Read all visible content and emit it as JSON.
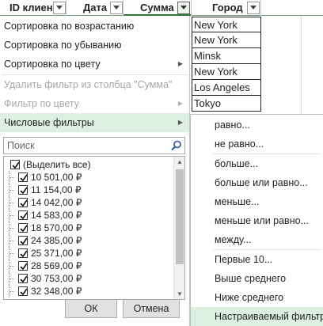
{
  "headers": {
    "id": "ID клиен",
    "date": "Дата",
    "sum": "Сумма",
    "city": "Город"
  },
  "cities": [
    "New York",
    "New York",
    "Minsk",
    "New York",
    "Los Angeles",
    "Tokyo"
  ],
  "menu": {
    "sort_asc": "Сортировка по возрастанию",
    "sort_desc": "Сортировка по убыванию",
    "sort_color": "Сортировка по цвету",
    "clear_filter": "Удалить фильтр из столбца \"Сумма\"",
    "filter_color": "Фильтр по цвету",
    "number_filters": "Числовые фильтры"
  },
  "search": {
    "placeholder": "Поиск"
  },
  "values": {
    "select_all": "(Выделить все)",
    "items": [
      "10 501,00 ₽",
      "11 154,00 ₽",
      "14 042,00 ₽",
      "14 583,00 ₽",
      "18 570,00 ₽",
      "24 385,00 ₽",
      "25 371,00 ₽",
      "28 569,00 ₽",
      "30 753,00 ₽",
      "32 348,00 ₽"
    ]
  },
  "buttons": {
    "ok": "ОК",
    "cancel": "Отмена"
  },
  "submenu": {
    "equals": "равно...",
    "not_equals": "не равно...",
    "greater": "больше...",
    "greater_equal": "больше или равно...",
    "less": "меньше...",
    "less_equal": "меньше или равно...",
    "between": "между...",
    "top10": "Первые 10...",
    "above_avg": "Выше среднего",
    "below_avg": "Ниже среднего",
    "custom": "Настраиваемый фильтр..."
  },
  "colors": {
    "hover": "#dcefe0",
    "accent": "#2e7d32"
  }
}
